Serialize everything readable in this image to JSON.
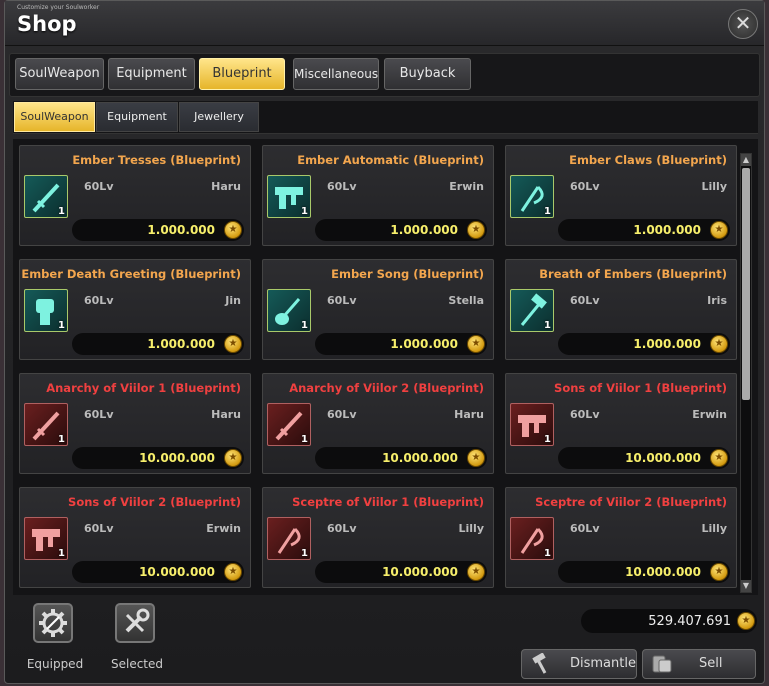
{
  "window": {
    "subtitle": "Customize your Soulworker",
    "title": "Shop",
    "close_glyph": "✕"
  },
  "main_tabs": [
    {
      "label": "SoulWeapon",
      "active": false
    },
    {
      "label": "Equipment",
      "active": false
    },
    {
      "label": "Blueprint",
      "active": true
    },
    {
      "label": "Miscellaneous",
      "active": false
    },
    {
      "label": "Buyback",
      "active": false
    }
  ],
  "sub_tabs": [
    {
      "label": "SoulWeapon",
      "active": true
    },
    {
      "label": "Equipment",
      "active": false
    },
    {
      "label": "Jewellery",
      "active": false
    }
  ],
  "items": [
    {
      "name": "Ember Tresses (Blueprint)",
      "level": "60Lv",
      "owner": "Haru",
      "price": "1.000.000",
      "qty": "1",
      "rarity": "orange",
      "icon": "sword-icon"
    },
    {
      "name": "Ember Automatic (Blueprint)",
      "level": "60Lv",
      "owner": "Erwin",
      "price": "1.000.000",
      "qty": "1",
      "rarity": "orange",
      "icon": "gun-icon"
    },
    {
      "name": "Ember Claws (Blueprint)",
      "level": "60Lv",
      "owner": "Lilly",
      "price": "1.000.000",
      "qty": "1",
      "rarity": "orange",
      "icon": "scythe-icon"
    },
    {
      "name": "Ember Death Greeting (Blueprint)",
      "level": "60Lv",
      "owner": "Jin",
      "price": "1.000.000",
      "qty": "1",
      "rarity": "orange",
      "icon": "gauntlet-icon"
    },
    {
      "name": "Ember Song (Blueprint)",
      "level": "60Lv",
      "owner": "Stella",
      "price": "1.000.000",
      "qty": "1",
      "rarity": "orange",
      "icon": "guitar-icon"
    },
    {
      "name": "Breath of Embers (Blueprint)",
      "level": "60Lv",
      "owner": "Iris",
      "price": "1.000.000",
      "qty": "1",
      "rarity": "orange",
      "icon": "hammer-icon"
    },
    {
      "name": "Anarchy of Viilor 1 (Blueprint)",
      "level": "60Lv",
      "owner": "Haru",
      "price": "10.000.000",
      "qty": "1",
      "rarity": "red",
      "icon": "sword-icon"
    },
    {
      "name": "Anarchy of Viilor 2 (Blueprint)",
      "level": "60Lv",
      "owner": "Haru",
      "price": "10.000.000",
      "qty": "1",
      "rarity": "red",
      "icon": "sword-icon"
    },
    {
      "name": "Sons of Viilor 1 (Blueprint)",
      "level": "60Lv",
      "owner": "Erwin",
      "price": "10.000.000",
      "qty": "1",
      "rarity": "red",
      "icon": "gun-icon"
    },
    {
      "name": "Sons of Viilor 2 (Blueprint)",
      "level": "60Lv",
      "owner": "Erwin",
      "price": "10.000.000",
      "qty": "1",
      "rarity": "red",
      "icon": "gun-icon"
    },
    {
      "name": "Sceptre of Viilor 1 (Blueprint)",
      "level": "60Lv",
      "owner": "Lilly",
      "price": "10.000.000",
      "qty": "1",
      "rarity": "red",
      "icon": "scythe-icon"
    },
    {
      "name": "Sceptre of Viilor 2 (Blueprint)",
      "level": "60Lv",
      "owner": "Lilly",
      "price": "10.000.000",
      "qty": "1",
      "rarity": "red",
      "icon": "scythe-icon"
    }
  ],
  "currency_icon": "gold-coin-icon",
  "colors": {
    "rarity_orange": "#f3a64e",
    "rarity_red": "#f04040",
    "price_yellow": "#f7ef6b",
    "tab_active": "#f0c040"
  },
  "footer": {
    "equipped_label": "Equipped",
    "selected_label": "Selected",
    "balance": "529.407.691",
    "dismantle_label": "Dismantle",
    "sell_label": "Sell"
  }
}
